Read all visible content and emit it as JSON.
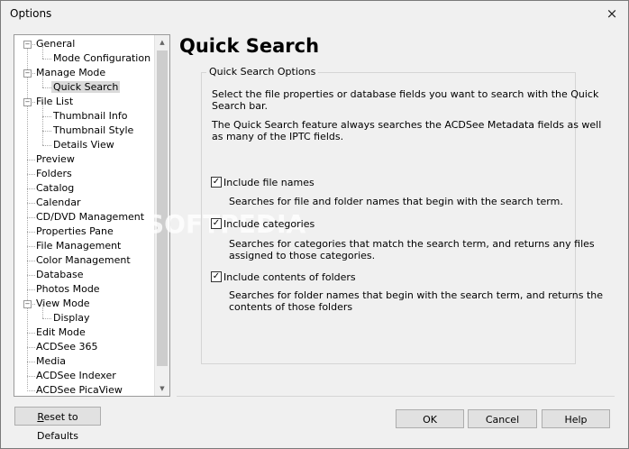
{
  "window": {
    "title": "Options",
    "close_symbol": "×"
  },
  "tree": {
    "expander_open": "−",
    "items": [
      {
        "label": "General"
      },
      {
        "label": "Mode Configuration"
      },
      {
        "label": "Manage Mode"
      },
      {
        "label": "Quick Search",
        "selected": true
      },
      {
        "label": "File List"
      },
      {
        "label": "Thumbnail Info"
      },
      {
        "label": "Thumbnail Style"
      },
      {
        "label": "Details View"
      },
      {
        "label": "Preview"
      },
      {
        "label": "Folders"
      },
      {
        "label": "Catalog"
      },
      {
        "label": "Calendar"
      },
      {
        "label": "CD/DVD Management"
      },
      {
        "label": "Properties Pane"
      },
      {
        "label": "File Management"
      },
      {
        "label": "Color Management"
      },
      {
        "label": "Database"
      },
      {
        "label": "Photos Mode"
      },
      {
        "label": "View Mode"
      },
      {
        "label": "Display"
      },
      {
        "label": "Edit Mode"
      },
      {
        "label": "ACDSee 365"
      },
      {
        "label": "Media"
      },
      {
        "label": "ACDSee Indexer"
      },
      {
        "label": "ACDSee PicaView"
      }
    ]
  },
  "panel": {
    "title": "Quick Search",
    "group_title": "Quick Search Options",
    "description_1_line_1": "Select the file properties or database fields you want to search with the Quick",
    "description_1_line_2": "Search bar.",
    "description_2_line_1": "The Quick Search feature always searches the ACDSee Metadata fields as well",
    "description_2_line_2": "as many of the IPTC fields.",
    "options": [
      {
        "label": "Include file names",
        "checked": true,
        "help_line_1": "Searches for file and folder names that begin with the search term.",
        "help_line_2": ""
      },
      {
        "label": "Include categories",
        "checked": true,
        "help_line_1": "Searches for categories that match the search term, and returns any files",
        "help_line_2": "assigned to those categories."
      },
      {
        "label": "Include contents of folders",
        "checked": true,
        "help_line_1": "Searches for folder names that begin with the search term, and returns the",
        "help_line_2": "contents of those folders"
      }
    ]
  },
  "buttons": {
    "reset_prefix": "R",
    "reset_rest": "eset to Defaults",
    "ok": "OK",
    "cancel": "Cancel",
    "help": "Help"
  },
  "watermark": "SOFTPEDIA",
  "check_mark": "✓"
}
